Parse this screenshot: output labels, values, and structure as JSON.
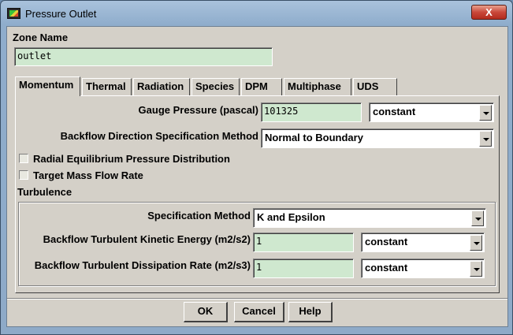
{
  "window": {
    "title": "Pressure Outlet",
    "close_label": "X"
  },
  "zone": {
    "label": "Zone Name",
    "value": "outlet"
  },
  "tabs": [
    {
      "label": "Momentum",
      "active": true
    },
    {
      "label": "Thermal"
    },
    {
      "label": "Radiation"
    },
    {
      "label": "Species"
    },
    {
      "label": "DPM"
    },
    {
      "label": "Multiphase"
    },
    {
      "label": "UDS"
    }
  ],
  "momentum": {
    "gauge_pressure_label": "Gauge Pressure (pascal)",
    "gauge_pressure_value": "101325",
    "gauge_pressure_method": "constant",
    "backflow_dir_label": "Backflow Direction Specification Method",
    "backflow_dir_value": "Normal to Boundary",
    "radial_eq_label": "Radial Equilibrium Pressure Distribution",
    "radial_eq_checked": false,
    "target_mass_label": "Target Mass Flow Rate",
    "target_mass_checked": false
  },
  "turbulence": {
    "title": "Turbulence",
    "spec_method_label": "Specification Method",
    "spec_method_value": "K and Epsilon",
    "tke_label": "Backflow Turbulent Kinetic Energy (m2/s2)",
    "tke_value": "1",
    "tke_method": "constant",
    "tdr_label": "Backflow Turbulent Dissipation Rate (m2/s3)",
    "tdr_value": "1",
    "tdr_method": "constant"
  },
  "buttons": {
    "ok": "OK",
    "cancel": "Cancel",
    "help": "Help"
  },
  "colors": {
    "field_bg": "#cfe8cf",
    "dialog_bg": "#d4d0c8",
    "close_red": "#c9483a"
  }
}
